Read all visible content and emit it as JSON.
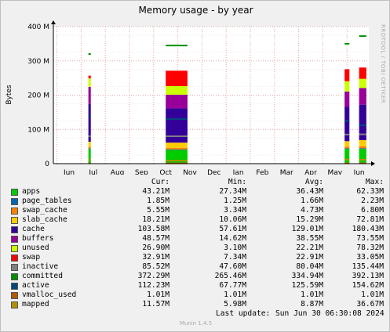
{
  "chart_data": {
    "type": "area",
    "title": "Memory usage - by year",
    "ylabel": "Bytes",
    "xlabel": "",
    "ylim": [
      0,
      400
    ],
    "y_unit": "M",
    "y_ticks": [
      "0",
      "100 M",
      "200 M",
      "300 M",
      "400 M"
    ],
    "x_ticks": [
      "Jun",
      "Jul",
      "Aug",
      "Sep",
      "Oct",
      "Nov",
      "Dec",
      "Jan",
      "Feb",
      "Mar",
      "Apr",
      "May",
      "Jun"
    ],
    "grid": true,
    "legend_position": "bottom",
    "stacked_order": [
      "apps",
      "page_tables",
      "swap_cache",
      "slab_cache",
      "cache",
      "buffers",
      "unused",
      "swap"
    ],
    "line_series": [
      "inactive",
      "committed",
      "active",
      "vmalloc_used",
      "mapped"
    ],
    "segments": [
      {
        "start": 0.8,
        "end": 0.9,
        "values": {
          "apps": 43,
          "page_tables": 1.5,
          "swap_cache": 4.5,
          "slab_cache": 15,
          "cache": 110,
          "buffers": 50,
          "unused": 25,
          "swap": 8,
          "inactive": 80,
          "committed": 320,
          "active": 140,
          "vmalloc_used": 1,
          "mapped": 11
        }
      },
      {
        "start": 4.0,
        "end": 4.9,
        "values": {
          "apps": 40,
          "page_tables": 1.6,
          "swap_cache": 4.7,
          "slab_cache": 15,
          "cache": 100,
          "buffers": 40,
          "unused": 25,
          "swap": 45,
          "inactive": 80,
          "committed": 345,
          "active": 130,
          "vmalloc_used": 1,
          "mapped": 9
        }
      },
      {
        "start": 11.4,
        "end": 11.6,
        "values": {
          "apps": 43,
          "page_tables": 1.7,
          "swap_cache": 5,
          "slab_cache": 16,
          "cache": 100,
          "buffers": 45,
          "unused": 30,
          "swap": 35,
          "inactive": 85,
          "committed": 350,
          "active": 125,
          "vmalloc_used": 1,
          "mapped": 12
        }
      },
      {
        "start": 12.0,
        "end": 12.3,
        "values": {
          "apps": 43,
          "page_tables": 1.85,
          "swap_cache": 5.55,
          "slab_cache": 18.21,
          "cache": 103.58,
          "buffers": 48.57,
          "unused": 26.9,
          "swap": 32.91,
          "inactive": 85.52,
          "committed": 372.29,
          "active": 112.23,
          "vmalloc_used": 1.01,
          "mapped": 11.57
        }
      }
    ],
    "series": [
      {
        "name": "apps",
        "color": "#00cc00",
        "cur": "43.21M",
        "min": "27.34M",
        "avg": "36.43M",
        "max": "62.33M"
      },
      {
        "name": "page_tables",
        "color": "#0066b3",
        "cur": "1.85M",
        "min": "1.25M",
        "avg": "1.66M",
        "max": "2.23M"
      },
      {
        "name": "swap_cache",
        "color": "#ff8000",
        "cur": "5.55M",
        "min": "3.34M",
        "avg": "4.73M",
        "max": "6.80M"
      },
      {
        "name": "slab_cache",
        "color": "#ffcc00",
        "cur": "18.21M",
        "min": "10.06M",
        "avg": "15.29M",
        "max": "72.81M"
      },
      {
        "name": "cache",
        "color": "#330099",
        "cur": "103.58M",
        "min": "57.61M",
        "avg": "129.01M",
        "max": "180.43M"
      },
      {
        "name": "buffers",
        "color": "#990099",
        "cur": "48.57M",
        "min": "14.62M",
        "avg": "38.55M",
        "max": "73.55M"
      },
      {
        "name": "unused",
        "color": "#ccff00",
        "cur": "26.90M",
        "min": "3.10M",
        "avg": "22.21M",
        "max": "78.32M"
      },
      {
        "name": "swap",
        "color": "#ff0000",
        "cur": "32.91M",
        "min": "7.34M",
        "avg": "22.91M",
        "max": "33.05M"
      },
      {
        "name": "inactive",
        "color": "#808080",
        "cur": "85.52M",
        "min": "47.60M",
        "avg": "80.04M",
        "max": "135.44M"
      },
      {
        "name": "committed",
        "color": "#008f00",
        "cur": "372.29M",
        "min": "265.46M",
        "avg": "334.94M",
        "max": "392.13M"
      },
      {
        "name": "active",
        "color": "#00487d",
        "cur": "112.23M",
        "min": "67.77M",
        "avg": "125.59M",
        "max": "154.62M"
      },
      {
        "name": "vmalloc_used",
        "color": "#b35a00",
        "cur": "1.01M",
        "min": "1.01M",
        "avg": "1.01M",
        "max": "1.01M"
      },
      {
        "name": "mapped",
        "color": "#b38f00",
        "cur": "11.57M",
        "min": "5.98M",
        "avg": "8.87M",
        "max": "36.67M"
      }
    ]
  },
  "legend": {
    "headers": {
      "cur": "Cur:",
      "min": "Min:",
      "avg": "Avg:",
      "max": "Max:"
    }
  },
  "last_update": {
    "label": "Last update:",
    "value": "Sun Jun 30 06:30:08 2024"
  },
  "side_credit": "RRDTOOL / TOBI OETIKER",
  "footer": "Munin 1.4.5"
}
